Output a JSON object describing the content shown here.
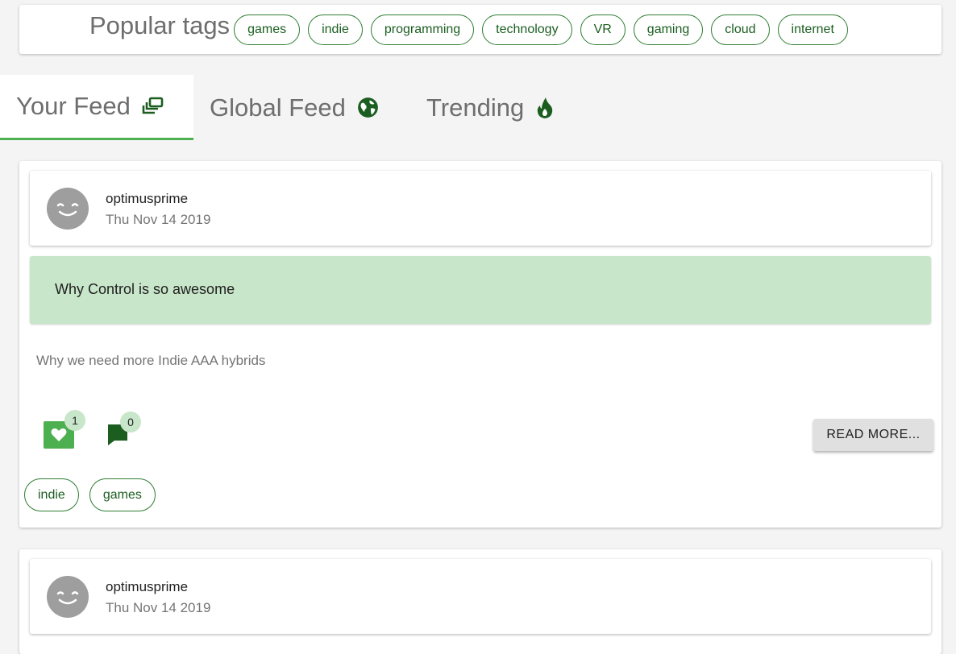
{
  "popular_tags": {
    "title": "Popular tags",
    "tags": [
      "games",
      "indie",
      "programming",
      "technology",
      "VR",
      "gaming",
      "cloud",
      "internet"
    ]
  },
  "tabs": [
    {
      "label": "Your Feed",
      "icon": "collections-icon",
      "active": true
    },
    {
      "label": "Global Feed",
      "icon": "globe-icon",
      "active": false
    },
    {
      "label": "Trending",
      "icon": "flame-icon",
      "active": false
    }
  ],
  "posts": [
    {
      "author": "optimusprime",
      "date": "Thu Nov 14 2019",
      "title": "Why Control is so awesome",
      "description": "Why we need more Indie AAA hybrids",
      "likes": "1",
      "comments": "0",
      "read_more_label": "READ MORE...",
      "tags": [
        "indie",
        "games"
      ]
    },
    {
      "author": "optimusprime",
      "date": "Thu Nov 14 2019"
    }
  ],
  "colors": {
    "accent": "#4caf50",
    "accent_dark": "#1b5e20",
    "title_bg": "#c8e6c9",
    "background": "#f4f4f4"
  }
}
